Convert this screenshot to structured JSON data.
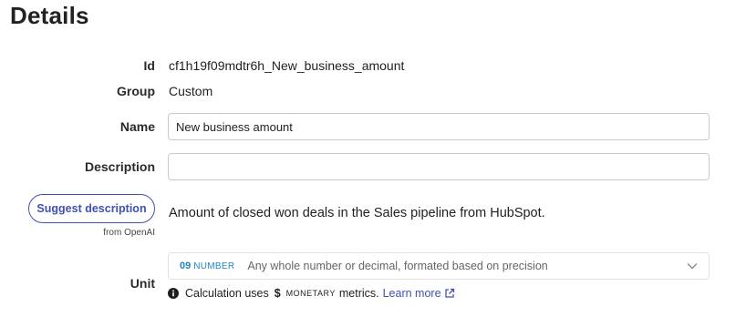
{
  "page": {
    "title": "Details"
  },
  "fields": {
    "id": {
      "label": "Id",
      "value": "cf1h19f09mdtr6h_New_business_amount"
    },
    "group": {
      "label": "Group",
      "value": "Custom"
    },
    "name": {
      "label": "Name",
      "value": "New business amount"
    },
    "description": {
      "label": "Description",
      "value": ""
    }
  },
  "suggest": {
    "button_label": "Suggest description",
    "source": "from OpenAI",
    "suggestion_text": "Amount of closed won deals in the Sales pipeline from HubSpot."
  },
  "unit": {
    "label": "Unit",
    "code": "09",
    "type": "NUMBER",
    "description": "Any whole number or decimal, formated based on precision",
    "note_prefix": "Calculation uses",
    "note_symbol": "$",
    "note_keyword": "MONETARY",
    "note_suffix": "metrics.",
    "learn_more": "Learn more"
  },
  "colors": {
    "accent": "#3f51b5",
    "unit_accent": "#1e88c8"
  },
  "icons": {
    "unit_dropdown": "chevron-down-icon",
    "info": "info-icon",
    "external": "external-link-icon"
  }
}
